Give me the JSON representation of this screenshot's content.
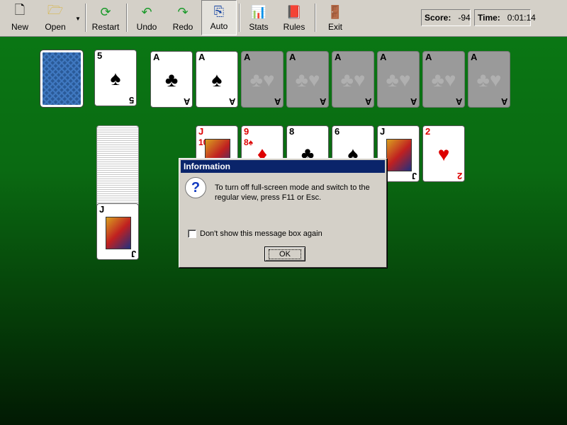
{
  "toolbar": {
    "buttons": [
      {
        "label": "New",
        "icon": "new-document-icon"
      },
      {
        "label": "Open",
        "icon": "folder-open-icon"
      },
      {
        "label": "Restart",
        "icon": "restart-icon"
      },
      {
        "label": "Undo",
        "icon": "undo-icon"
      },
      {
        "label": "Redo",
        "icon": "redo-icon"
      },
      {
        "label": "Auto",
        "icon": "auto-icon"
      },
      {
        "label": "Stats",
        "icon": "bar-chart-icon"
      },
      {
        "label": "Rules",
        "icon": "book-icon"
      },
      {
        "label": "Exit",
        "icon": "exit-door-icon"
      }
    ],
    "score_label": "Score:",
    "score_value": "-94",
    "time_label": "Time:",
    "time_value": "0:01:14"
  },
  "game": {
    "waste_top": {
      "rank": "5",
      "suit": "♠"
    },
    "foundations": [
      {
        "rank": "A",
        "suit": "♣"
      },
      {
        "rank": "A",
        "suit": "♠"
      },
      {
        "rank": "A",
        "suit": "♣♥",
        "empty": true
      },
      {
        "rank": "A",
        "suit": "♣♥",
        "empty": true
      },
      {
        "rank": "A",
        "suit": "♣♥",
        "empty": true
      },
      {
        "rank": "A",
        "suit": "♣♥",
        "empty": true
      },
      {
        "rank": "A",
        "suit": "♣♥",
        "empty": true
      },
      {
        "rank": "A",
        "suit": "♣♥",
        "empty": true
      }
    ],
    "tableau": [
      {
        "rank": "J",
        "suit": "♣"
      },
      {
        "rank": "J",
        "suit": "♥",
        "under": "10♥"
      },
      {
        "rank": "9",
        "suit": "♦",
        "under": "8♠"
      },
      {
        "rank": "8",
        "suit": "♣"
      },
      {
        "rank": "6",
        "suit": "♠"
      },
      {
        "rank": "J",
        "suit": "♠"
      },
      {
        "rank": "2",
        "suit": "♥"
      }
    ]
  },
  "dialog": {
    "title": "Information",
    "message": "To turn off full-screen mode and switch to the regular view, press F11 or Esc.",
    "checkbox_label": "Don't show this message box again",
    "ok_label": "OK"
  }
}
